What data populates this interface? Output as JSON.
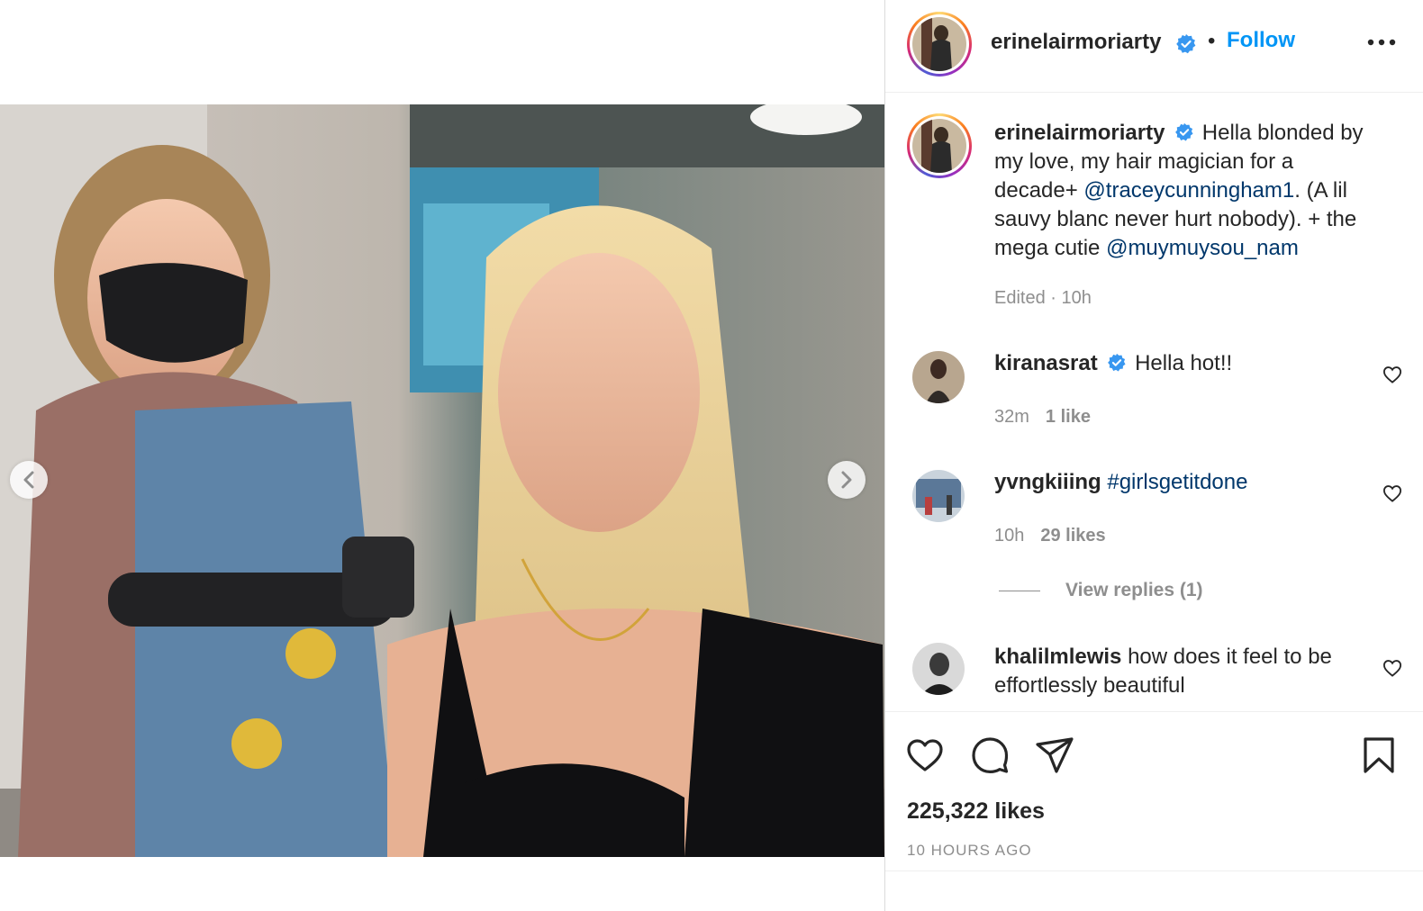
{
  "post": {
    "username": "erinelairmoriarty",
    "verified": true,
    "separator": "•",
    "follow_label": "Follow",
    "more_label": "More options",
    "caption": {
      "username": "erinelairmoriarty",
      "text_part1": "Hella blonded by my love, my hair magician for a decade+ ",
      "mention1": "@traceycunningham1",
      "text_part2": ". (A lil sauvy blanc never hurt nobody). + the mega cutie ",
      "mention2": "@muymuysou_nam",
      "meta": "Edited · 10h"
    },
    "likes_text": "225,322 likes",
    "timestamp": "10 HOURS AGO"
  },
  "comments": [
    {
      "username": "kiranasrat",
      "verified": true,
      "text": "Hella hot!!",
      "time": "32m",
      "likes": "1 like"
    },
    {
      "username": "yvngkiiing",
      "verified": false,
      "hashtag": "#girlsgetitdone",
      "time": "10h",
      "likes": "29 likes",
      "view_replies": "View replies (1)"
    },
    {
      "username": "khalilmlewis",
      "verified": false,
      "text": "how does it feel to be effortlessly beautiful"
    }
  ],
  "colors": {
    "link": "#0095f6",
    "mention": "#00376b",
    "verified": "#3897f0",
    "muted": "#8e8e8e"
  },
  "icons": [
    "heart-icon",
    "comment-icon",
    "share-icon",
    "bookmark-icon",
    "chevron-left-icon",
    "chevron-right-icon",
    "more-icon",
    "verified-badge-icon"
  ]
}
